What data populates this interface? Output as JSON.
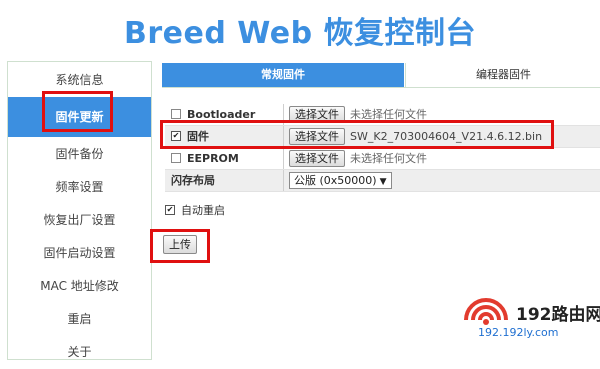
{
  "header": {
    "title": "Breed Web 恢复控制台"
  },
  "sidebar": {
    "items": [
      {
        "label": "系统信息"
      },
      {
        "label": "固件更新"
      },
      {
        "label": "固件备份"
      },
      {
        "label": "频率设置"
      },
      {
        "label": "恢复出厂设置"
      },
      {
        "label": "固件启动设置"
      },
      {
        "label": "MAC 地址修改"
      },
      {
        "label": "重启"
      },
      {
        "label": "关于"
      }
    ],
    "active_index": 1
  },
  "tabs": [
    {
      "label": "常规固件",
      "active": true
    },
    {
      "label": "编程器固件",
      "active": false
    }
  ],
  "form": {
    "rows": [
      {
        "label": "Bootloader",
        "checked": false,
        "button": "选择文件",
        "file": "未选择任何文件"
      },
      {
        "label": "固件",
        "checked": true,
        "button": "选择文件",
        "file": "SW_K2_703004604_V21.4.6.12.bin"
      },
      {
        "label": "EEPROM",
        "checked": false,
        "button": "选择文件",
        "file": "未选择任何文件"
      }
    ],
    "layout": {
      "label": "闪存布局",
      "selected": "公版 (0x50000)"
    }
  },
  "auto_reboot": {
    "label": "自动重启",
    "checked": true
  },
  "upload": {
    "label": "上传"
  },
  "watermark": {
    "brand": "192路由网",
    "site": "192.192ly.com"
  },
  "colors": {
    "accent": "#3c8fe0",
    "highlight": "#e01010"
  }
}
